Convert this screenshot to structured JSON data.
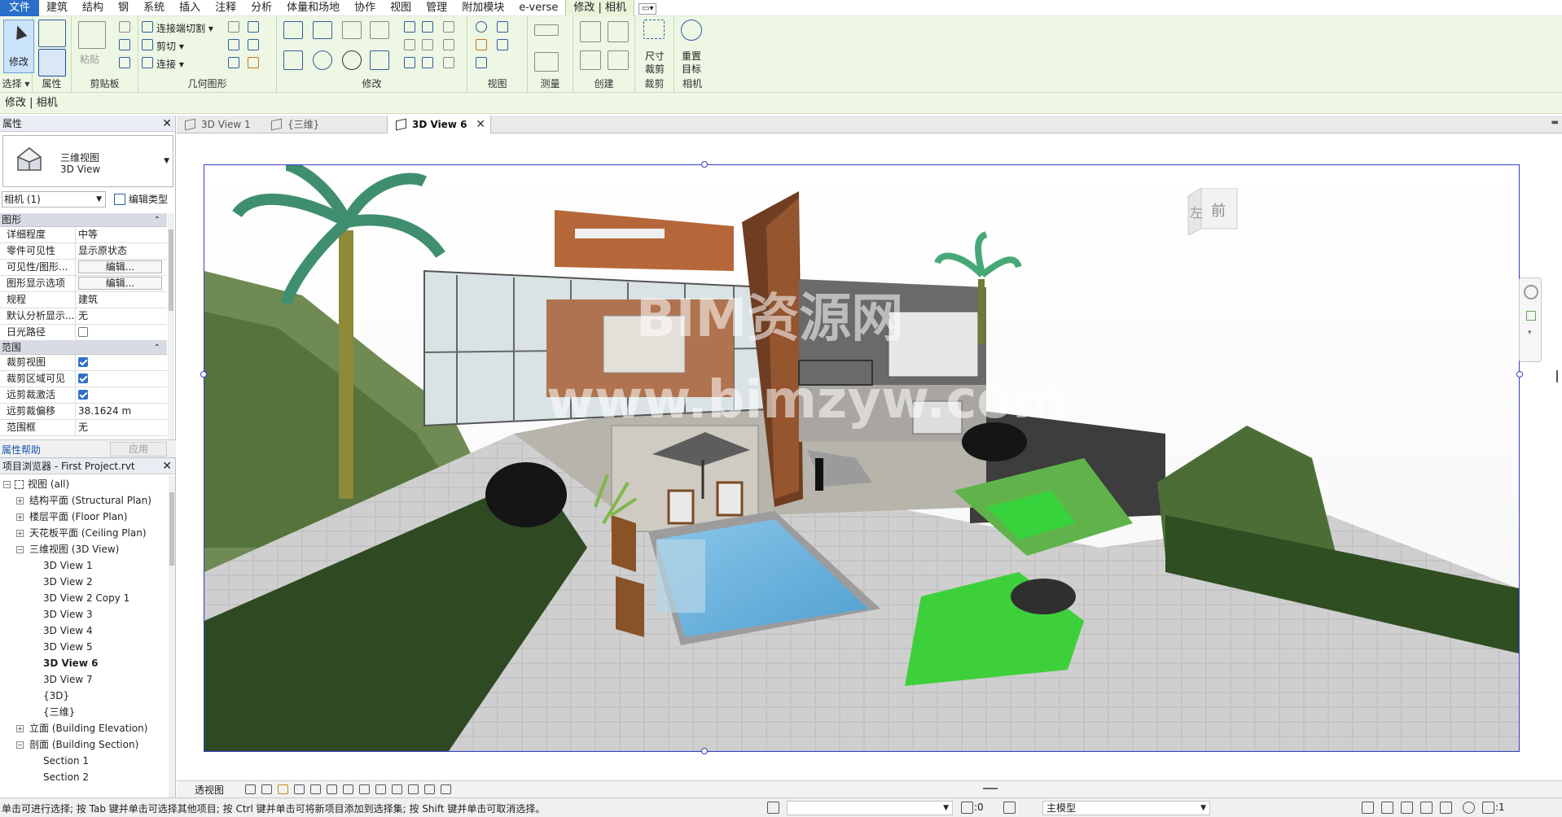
{
  "menu": {
    "items": [
      "文件",
      "建筑",
      "结构",
      "钢",
      "系统",
      "插入",
      "注释",
      "分析",
      "体量和场地",
      "协作",
      "视图",
      "管理",
      "附加模块",
      "e-verse",
      "修改 | 相机"
    ],
    "extra": "▭▾"
  },
  "ribbon": {
    "modify_label": "修改",
    "panels": {
      "select": "选择 ▾",
      "properties": "属性",
      "clipboard": "剪贴板",
      "geometry": "几何图形",
      "modify": "修改",
      "view": "视图",
      "measure": "测量",
      "create": "创建",
      "crop": "裁剪",
      "camera": "相机"
    },
    "paste_label": "粘贴",
    "geometry_buttons": {
      "join_cut": "连接端切割 ▾",
      "cut": "剪切 ▾",
      "join": "连接 ▾"
    },
    "crop_button": "尺寸裁剪",
    "crop_button_line1": "尺寸",
    "crop_button_line2": "裁剪",
    "reset_button_line1": "重置",
    "reset_button_line2": "目标"
  },
  "context_bar": "修改 | 相机",
  "properties": {
    "title": "属性",
    "type_line1": "三维视图",
    "type_line2": "3D View",
    "instance": "相机 (1)",
    "edit_type": "编辑类型",
    "groups": [
      {
        "name": "图形",
        "rows": [
          {
            "k": "详细程度",
            "v": "中等",
            "kind": "text"
          },
          {
            "k": "零件可见性",
            "v": "显示原状态",
            "kind": "text"
          },
          {
            "k": "可见性/图形...",
            "v": "编辑...",
            "kind": "button"
          },
          {
            "k": "图形显示选项",
            "v": "编辑...",
            "kind": "button"
          },
          {
            "k": "规程",
            "v": "建筑",
            "kind": "text"
          },
          {
            "k": "默认分析显示...",
            "v": "无",
            "kind": "text"
          },
          {
            "k": "日光路径",
            "v": false,
            "kind": "check"
          }
        ]
      },
      {
        "name": "范围",
        "rows": [
          {
            "k": "裁剪视图",
            "v": true,
            "kind": "check"
          },
          {
            "k": "裁剪区域可见",
            "v": true,
            "kind": "check"
          },
          {
            "k": "远剪裁激活",
            "v": true,
            "kind": "check"
          },
          {
            "k": "远剪裁偏移",
            "v": "38.1624 m",
            "kind": "text"
          },
          {
            "k": "范围框",
            "v": "无",
            "kind": "text"
          }
        ]
      }
    ],
    "help_link": "属性帮助",
    "apply": "应用"
  },
  "browser": {
    "title": "项目浏览器 - First Project.rvt",
    "nodes": [
      {
        "label": "视图 (all)",
        "level": 0,
        "exp": "−",
        "icon": true
      },
      {
        "label": "结构平面 (Structural Plan)",
        "level": 1,
        "exp": "+"
      },
      {
        "label": "楼层平面 (Floor Plan)",
        "level": 1,
        "exp": "+"
      },
      {
        "label": "天花板平面 (Ceiling Plan)",
        "level": 1,
        "exp": "+"
      },
      {
        "label": "三维视图 (3D View)",
        "level": 1,
        "exp": "−"
      },
      {
        "label": "3D View 1",
        "level": 2
      },
      {
        "label": "3D View 2",
        "level": 2
      },
      {
        "label": "3D View 2 Copy 1",
        "level": 2
      },
      {
        "label": "3D View 3",
        "level": 2
      },
      {
        "label": "3D View 4",
        "level": 2
      },
      {
        "label": "3D View 5",
        "level": 2
      },
      {
        "label": "3D View 6",
        "level": 2,
        "bold": true
      },
      {
        "label": "3D View 7",
        "level": 2
      },
      {
        "label": "{3D}",
        "level": 2
      },
      {
        "label": "{三维}",
        "level": 2
      },
      {
        "label": "立面 (Building Elevation)",
        "level": 1,
        "exp": "+"
      },
      {
        "label": "剖面 (Building Section)",
        "level": 1,
        "exp": "−"
      },
      {
        "label": "Section 1",
        "level": 2
      },
      {
        "label": "Section 2",
        "level": 2
      }
    ]
  },
  "tabs": [
    {
      "label": "3D View 1",
      "active": false
    },
    {
      "label": "{三维}",
      "active": false
    },
    {
      "label": "3D View 6",
      "active": true
    }
  ],
  "viewport": {
    "viewcube_left": "左",
    "viewcube_front": "前",
    "watermark_line1": "BIM资源网",
    "watermark_line2": "www.bimzyw.com"
  },
  "view_control": {
    "label": "透视图"
  },
  "status": {
    "message": "单击可进行选择; 按 Tab 键并单击可选择其他项目; 按 Ctrl 键并单击可将新项目添加到选择集; 按 Shift 键并单击可取消选择。",
    "count": ":0",
    "model": "主模型",
    "filter": ":1"
  },
  "colors": {
    "accent": "#2a6fc9",
    "ribbon": "#eef6e4",
    "crop_border": "#3340c8"
  }
}
